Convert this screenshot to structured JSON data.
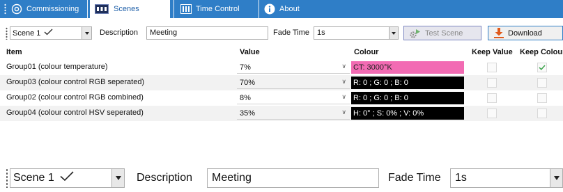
{
  "tabs": [
    {
      "label": "Commissioning",
      "icon": "commissioning-icon",
      "active": false
    },
    {
      "label": "Scenes",
      "icon": "scenes-icon",
      "active": true
    },
    {
      "label": "Time Control",
      "icon": "time-control-icon",
      "active": false
    },
    {
      "label": "About",
      "icon": "info-icon",
      "active": false
    }
  ],
  "toolbar": {
    "scene_value": "Scene 1",
    "description_label": "Description",
    "description_value": "Meeting",
    "fade_time_label": "Fade Time",
    "fade_time_value": "1s",
    "test_scene_label": "Test Scene",
    "download_label": "Download"
  },
  "table": {
    "columns": [
      "Item",
      "Value",
      "Colour",
      "Keep Value",
      "Keep Colour"
    ],
    "rows": [
      {
        "item": "Group01 (colour temperature)",
        "value": "7%",
        "colour": "CT: 3000°K",
        "colour_bg": "#f26bb3",
        "colour_fg": "#222222",
        "keep_value": false,
        "keep_colour": true
      },
      {
        "item": "Group03 (colour control RGB seperated)",
        "value": "70%",
        "colour": "R: 0 ; G: 0 ; B: 0",
        "colour_bg": "#000000",
        "colour_fg": "#ffffff",
        "keep_value": false,
        "keep_colour": false
      },
      {
        "item": "Group02 (colour control RGB combined)",
        "value": "8%",
        "colour": "R: 0 ; G: 0 ; B: 0",
        "colour_bg": "#000000",
        "colour_fg": "#ffffff",
        "keep_value": false,
        "keep_colour": false
      },
      {
        "item": "Group04 (colour control HSV seperated)",
        "value": "35%",
        "colour": "H: 0° ; S: 0% ; V: 0%",
        "colour_bg": "#000000",
        "colour_fg": "#ffffff",
        "keep_value": false,
        "keep_colour": false
      }
    ]
  },
  "zoomed_toolbar": {
    "scene_value": "Scene 1",
    "description_label": "Description",
    "description_value": "Meeting",
    "fade_time_label": "Fade Time",
    "fade_time_value": "1s"
  },
  "colors": {
    "tab_bar": "#2f7ec7",
    "active_tab_text": "#1e5fa8",
    "check_green": "#3aa34a",
    "download_arrow": "#e05a1c"
  }
}
